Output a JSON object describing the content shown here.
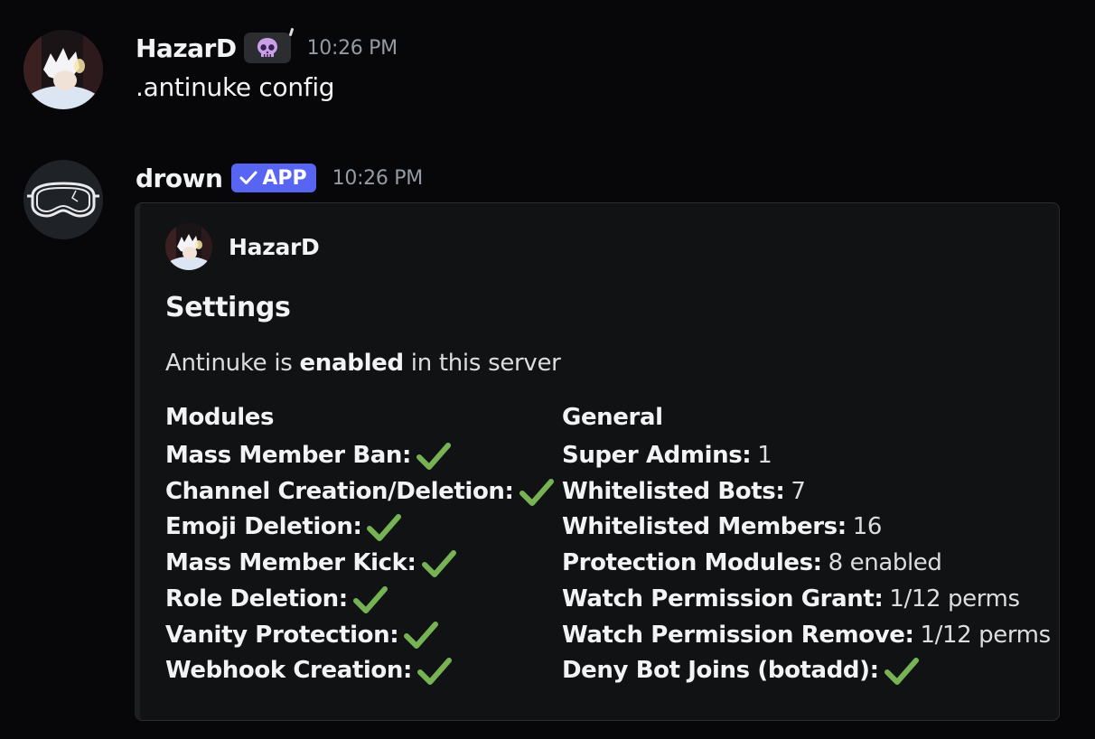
{
  "colors": {
    "background": "#070709",
    "embed_bg": "#111214",
    "app_badge": "#5865f2",
    "check": "#77b255",
    "timestamp": "#949ba4"
  },
  "messages": [
    {
      "author": "HazarD",
      "role_icon": "skull-icon",
      "timestamp": "10:26 PM",
      "content": ".antinuke config"
    },
    {
      "author": "drown",
      "badge": {
        "icon": "checkmark-icon",
        "label": "APP"
      },
      "timestamp": "10:26 PM",
      "embed": {
        "author": "HazarD",
        "title": "Settings",
        "description": {
          "prefix": "Antinuke is ",
          "bold": "enabled",
          "suffix": " in this server"
        },
        "fields": [
          {
            "name": "Modules",
            "lines": [
              {
                "key": "Mass Member Ban:",
                "icon": "check-mark-icon"
              },
              {
                "key": "Channel Creation/Deletion:",
                "icon": "check-mark-icon"
              },
              {
                "key": "Emoji Deletion:",
                "icon": "check-mark-icon"
              },
              {
                "key": "Mass Member Kick:",
                "icon": "check-mark-icon"
              },
              {
                "key": "Role Deletion:",
                "icon": "check-mark-icon"
              },
              {
                "key": "Vanity Protection:",
                "icon": "check-mark-icon"
              },
              {
                "key": "Webhook Creation:",
                "icon": "check-mark-icon"
              }
            ]
          },
          {
            "name": "General",
            "lines": [
              {
                "key": "Super Admins:",
                "value": "1"
              },
              {
                "key": "Whitelisted Bots:",
                "value": "7"
              },
              {
                "key": "Whitelisted Members:",
                "value": "16"
              },
              {
                "key": "Protection Modules:",
                "value": "8 enabled"
              },
              {
                "key": "Watch Permission Grant:",
                "value": "1/12 perms"
              },
              {
                "key": "Watch Permission Remove:",
                "value": "1/12 perms"
              },
              {
                "key": "Deny Bot Joins (botadd):",
                "icon": "check-mark-icon"
              }
            ]
          }
        ]
      }
    }
  ]
}
